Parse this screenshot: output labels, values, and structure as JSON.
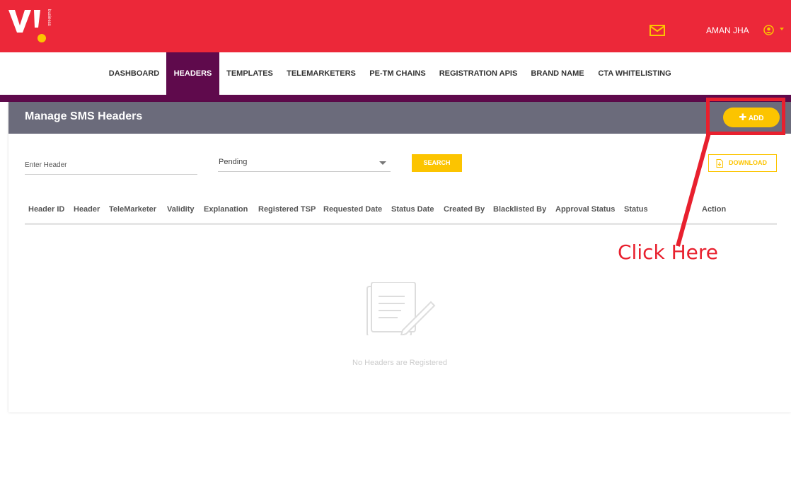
{
  "brand": {
    "logo_text": "VI",
    "logo_sub": "business",
    "primary_color": "#ec2839",
    "accent_color": "#fcc400",
    "nav_active_color": "#5f0a4c"
  },
  "topbar": {
    "user_name": "AMAN JHA",
    "mail_icon": "mail-icon",
    "user_icon": "user-circle-icon"
  },
  "nav": {
    "items": [
      {
        "label": "DASHBOARD",
        "active": false
      },
      {
        "label": "HEADERS",
        "active": true
      },
      {
        "label": "TEMPLATES",
        "active": false
      },
      {
        "label": "TELEMARKETERS",
        "active": false
      },
      {
        "label": "PE-TM CHAINS",
        "active": false
      },
      {
        "label": "REGISTRATION APIS",
        "active": false
      },
      {
        "label": "BRAND NAME",
        "active": false
      },
      {
        "label": "CTA WHITELISTING",
        "active": false
      }
    ]
  },
  "panel": {
    "title": "Manage SMS Headers",
    "add_label": "ADD",
    "filters": {
      "header_placeholder": "Enter Header",
      "status_value": "Pending",
      "search_label": "SEARCH",
      "download_label": "DOWNLOAD"
    },
    "table": {
      "columns": [
        "Header ID",
        "Header",
        "TeleMarketer",
        "Validity",
        "Explanation",
        "Registered TSP",
        "Requested Date",
        "Status Date",
        "Created By",
        "Blacklisted By",
        "Approval Status",
        "Status",
        "Action"
      ],
      "rows": []
    },
    "empty_message": "No Headers are Registered"
  },
  "annotation": {
    "text": "Click Here",
    "color": "#e8202e"
  }
}
